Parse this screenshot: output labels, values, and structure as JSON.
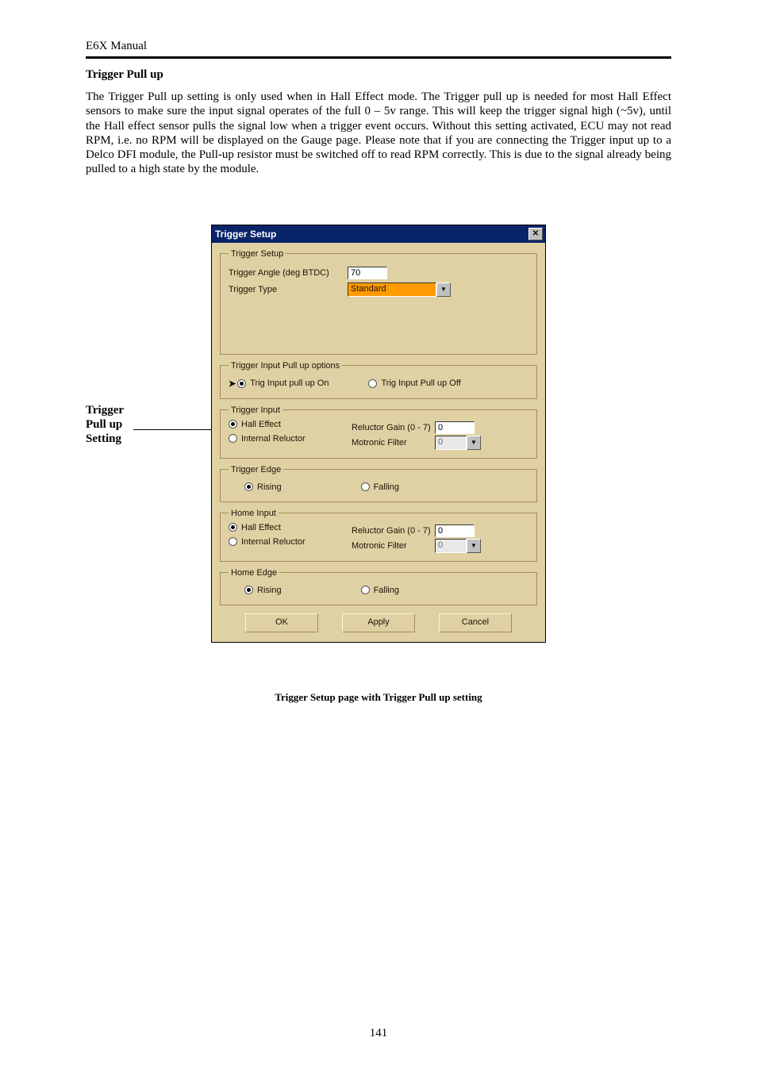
{
  "running_head": "E6X Manual",
  "section_title": "Trigger Pull up",
  "paragraph": "The Trigger Pull up setting is only used when in Hall Effect mode. The Trigger pull up is needed for most Hall Effect sensors to make sure the input signal operates of the full 0 – 5v range. This will keep the trigger signal high (~5v), until the Hall effect sensor pulls the signal low when a trigger event occurs. Without this setting activated, ECU may not read RPM, i.e. no RPM will be displayed on the Gauge page.  Please note that if you are connecting the Trigger input up to a Delco DFI module, the Pull-up resistor must be switched off to read RPM correctly. This is due to the signal already being pulled to a high state by the module.",
  "callout": {
    "line1": "Trigger",
    "line2": "Pull up",
    "line3": "Setting"
  },
  "dialog": {
    "title": "Trigger Setup",
    "close_glyph": "✕",
    "groups": {
      "trigger_setup": {
        "legend": "Trigger Setup",
        "trigger_angle_label": "Trigger Angle (deg BTDC)",
        "trigger_angle_value": "70",
        "trigger_type_label": "Trigger Type",
        "trigger_type_value": "Standard"
      },
      "pullup": {
        "legend": "Trigger Input Pull up options",
        "on_label": "Trig Input pull up On",
        "off_label": "Trig Input Pull up Off"
      },
      "trigger_input": {
        "legend": "Trigger Input",
        "hall_label": "Hall Effect",
        "reluctor_label": "Internal Reluctor",
        "gain_label": "Reluctor Gain (0 - 7)",
        "gain_value": "0",
        "filter_label": "Motronic Filter",
        "filter_value": "0"
      },
      "trigger_edge": {
        "legend": "Trigger Edge",
        "rising_label": "Rising",
        "falling_label": "Falling"
      },
      "home_input": {
        "legend": "Home Input",
        "hall_label": "Hall Effect",
        "reluctor_label": "Internal Reluctor",
        "gain_label": "Reluctor Gain (0 - 7)",
        "gain_value": "0",
        "filter_label": "Motronic Filter",
        "filter_value": "0"
      },
      "home_edge": {
        "legend": "Home Edge",
        "rising_label": "Rising",
        "falling_label": "Falling"
      }
    },
    "buttons": {
      "ok": "OK",
      "apply": "Apply",
      "cancel": "Cancel"
    }
  },
  "caption": "Trigger Setup page with Trigger Pull up setting",
  "page_number": "141"
}
